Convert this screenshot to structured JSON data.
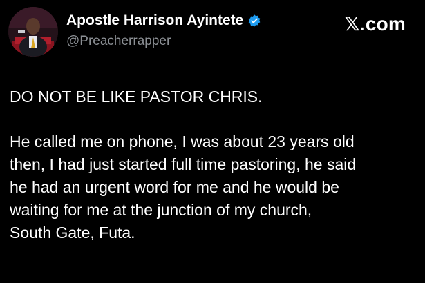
{
  "author": {
    "display_name": "Apostle Harrison Ayintete",
    "handle": "@Preacherrapper",
    "verified_badge_color": "#1d9bf0",
    "avatar_icon": "profile-photo"
  },
  "brand": {
    "label": "𝕏.com",
    "icon": "x-logo"
  },
  "tweet": {
    "headline": "DO NOT BE LIKE PASTOR CHRIS.",
    "lines": [
      "He called me on phone, I was about 23 years old",
      "then, I had just started full time pastoring, he said",
      "he had an urgent word for me and he would be",
      "waiting for me at the junction of my church,",
      "South Gate, Futa."
    ]
  },
  "colors": {
    "background": "#000000",
    "text": "#ffffff",
    "secondary_text": "#8b8f94"
  }
}
